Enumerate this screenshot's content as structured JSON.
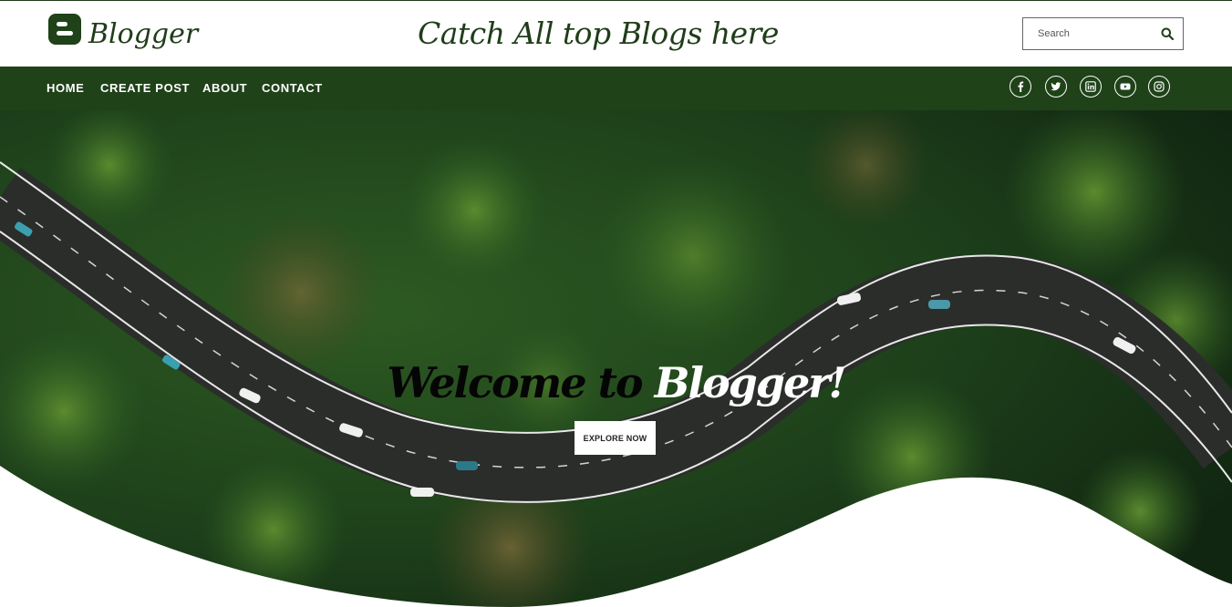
{
  "header": {
    "logo_text": "Blogger",
    "tagline": "Catch All top Blogs here",
    "search_placeholder": "Search"
  },
  "nav": {
    "items": [
      {
        "label": "HOME"
      },
      {
        "label": "CREATE POST"
      },
      {
        "label": "ABOUT"
      },
      {
        "label": "CONTACT"
      }
    ],
    "social_icons": [
      "facebook-icon",
      "twitter-icon",
      "linkedin-icon",
      "youtube-icon",
      "instagram-icon"
    ]
  },
  "hero": {
    "title_part1": "Welcome to",
    "title_part2": "Blogger!",
    "button_label": "EXPLORE NOW"
  },
  "colors": {
    "brand_green": "#1f4219",
    "text_green": "#1f3d19",
    "white": "#ffffff"
  }
}
